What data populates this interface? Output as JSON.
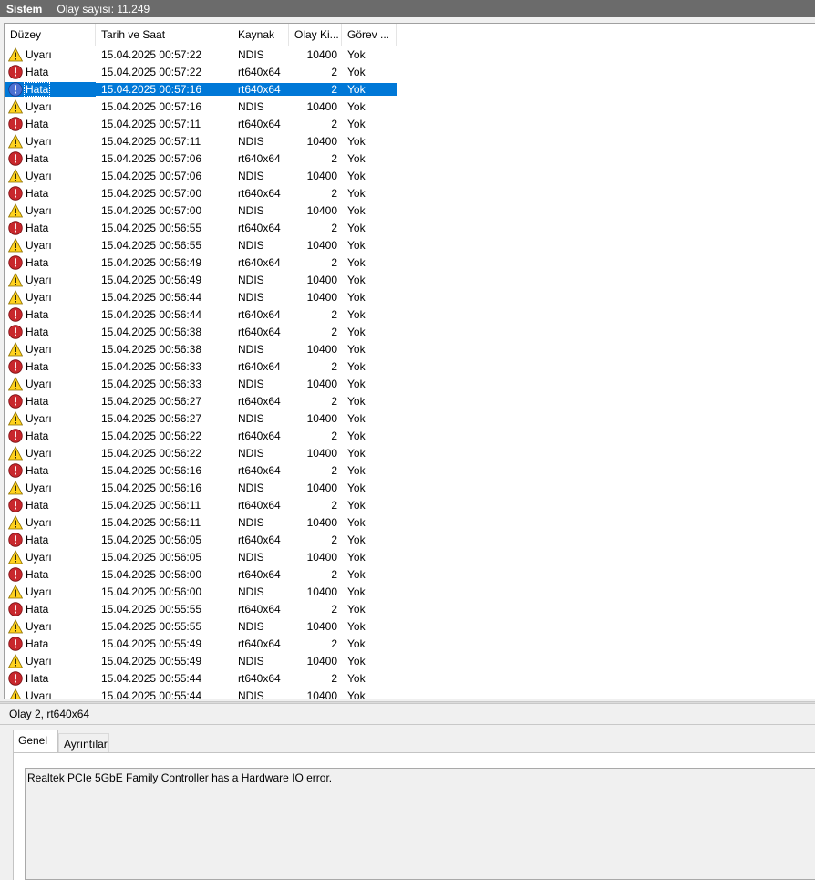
{
  "log": {
    "name": "Sistem",
    "count_text": "Olay sayısı: 11.249"
  },
  "columns": [
    "Düzey",
    "Tarih ve Saat",
    "Kaynak",
    "Olay Ki...",
    "Görev ..."
  ],
  "rows": [
    {
      "level": "Uyarı",
      "icon": "warning",
      "datetime": "15.04.2025 00:57:22",
      "source": "NDIS",
      "event_id": "10400",
      "task": "Yok"
    },
    {
      "level": "Hata",
      "icon": "error",
      "datetime": "15.04.2025 00:57:22",
      "source": "rt640x64",
      "event_id": "2",
      "task": "Yok"
    },
    {
      "level": "Hata",
      "icon": "error",
      "datetime": "15.04.2025 00:57:16",
      "source": "rt640x64",
      "event_id": "2",
      "task": "Yok",
      "selected": true
    },
    {
      "level": "Uyarı",
      "icon": "warning",
      "datetime": "15.04.2025 00:57:16",
      "source": "NDIS",
      "event_id": "10400",
      "task": "Yok"
    },
    {
      "level": "Hata",
      "icon": "error",
      "datetime": "15.04.2025 00:57:11",
      "source": "rt640x64",
      "event_id": "2",
      "task": "Yok"
    },
    {
      "level": "Uyarı",
      "icon": "warning",
      "datetime": "15.04.2025 00:57:11",
      "source": "NDIS",
      "event_id": "10400",
      "task": "Yok"
    },
    {
      "level": "Hata",
      "icon": "error",
      "datetime": "15.04.2025 00:57:06",
      "source": "rt640x64",
      "event_id": "2",
      "task": "Yok"
    },
    {
      "level": "Uyarı",
      "icon": "warning",
      "datetime": "15.04.2025 00:57:06",
      "source": "NDIS",
      "event_id": "10400",
      "task": "Yok"
    },
    {
      "level": "Hata",
      "icon": "error",
      "datetime": "15.04.2025 00:57:00",
      "source": "rt640x64",
      "event_id": "2",
      "task": "Yok"
    },
    {
      "level": "Uyarı",
      "icon": "warning",
      "datetime": "15.04.2025 00:57:00",
      "source": "NDIS",
      "event_id": "10400",
      "task": "Yok"
    },
    {
      "level": "Hata",
      "icon": "error",
      "datetime": "15.04.2025 00:56:55",
      "source": "rt640x64",
      "event_id": "2",
      "task": "Yok"
    },
    {
      "level": "Uyarı",
      "icon": "warning",
      "datetime": "15.04.2025 00:56:55",
      "source": "NDIS",
      "event_id": "10400",
      "task": "Yok"
    },
    {
      "level": "Hata",
      "icon": "error",
      "datetime": "15.04.2025 00:56:49",
      "source": "rt640x64",
      "event_id": "2",
      "task": "Yok"
    },
    {
      "level": "Uyarı",
      "icon": "warning",
      "datetime": "15.04.2025 00:56:49",
      "source": "NDIS",
      "event_id": "10400",
      "task": "Yok"
    },
    {
      "level": "Uyarı",
      "icon": "warning",
      "datetime": "15.04.2025 00:56:44",
      "source": "NDIS",
      "event_id": "10400",
      "task": "Yok"
    },
    {
      "level": "Hata",
      "icon": "error",
      "datetime": "15.04.2025 00:56:44",
      "source": "rt640x64",
      "event_id": "2",
      "task": "Yok"
    },
    {
      "level": "Hata",
      "icon": "error",
      "datetime": "15.04.2025 00:56:38",
      "source": "rt640x64",
      "event_id": "2",
      "task": "Yok"
    },
    {
      "level": "Uyarı",
      "icon": "warning",
      "datetime": "15.04.2025 00:56:38",
      "source": "NDIS",
      "event_id": "10400",
      "task": "Yok"
    },
    {
      "level": "Hata",
      "icon": "error",
      "datetime": "15.04.2025 00:56:33",
      "source": "rt640x64",
      "event_id": "2",
      "task": "Yok"
    },
    {
      "level": "Uyarı",
      "icon": "warning",
      "datetime": "15.04.2025 00:56:33",
      "source": "NDIS",
      "event_id": "10400",
      "task": "Yok"
    },
    {
      "level": "Hata",
      "icon": "error",
      "datetime": "15.04.2025 00:56:27",
      "source": "rt640x64",
      "event_id": "2",
      "task": "Yok"
    },
    {
      "level": "Uyarı",
      "icon": "warning",
      "datetime": "15.04.2025 00:56:27",
      "source": "NDIS",
      "event_id": "10400",
      "task": "Yok"
    },
    {
      "level": "Hata",
      "icon": "error",
      "datetime": "15.04.2025 00:56:22",
      "source": "rt640x64",
      "event_id": "2",
      "task": "Yok"
    },
    {
      "level": "Uyarı",
      "icon": "warning",
      "datetime": "15.04.2025 00:56:22",
      "source": "NDIS",
      "event_id": "10400",
      "task": "Yok"
    },
    {
      "level": "Hata",
      "icon": "error",
      "datetime": "15.04.2025 00:56:16",
      "source": "rt640x64",
      "event_id": "2",
      "task": "Yok"
    },
    {
      "level": "Uyarı",
      "icon": "warning",
      "datetime": "15.04.2025 00:56:16",
      "source": "NDIS",
      "event_id": "10400",
      "task": "Yok"
    },
    {
      "level": "Hata",
      "icon": "error",
      "datetime": "15.04.2025 00:56:11",
      "source": "rt640x64",
      "event_id": "2",
      "task": "Yok"
    },
    {
      "level": "Uyarı",
      "icon": "warning",
      "datetime": "15.04.2025 00:56:11",
      "source": "NDIS",
      "event_id": "10400",
      "task": "Yok"
    },
    {
      "level": "Hata",
      "icon": "error",
      "datetime": "15.04.2025 00:56:05",
      "source": "rt640x64",
      "event_id": "2",
      "task": "Yok"
    },
    {
      "level": "Uyarı",
      "icon": "warning",
      "datetime": "15.04.2025 00:56:05",
      "source": "NDIS",
      "event_id": "10400",
      "task": "Yok"
    },
    {
      "level": "Hata",
      "icon": "error",
      "datetime": "15.04.2025 00:56:00",
      "source": "rt640x64",
      "event_id": "2",
      "task": "Yok"
    },
    {
      "level": "Uyarı",
      "icon": "warning",
      "datetime": "15.04.2025 00:56:00",
      "source": "NDIS",
      "event_id": "10400",
      "task": "Yok"
    },
    {
      "level": "Hata",
      "icon": "error",
      "datetime": "15.04.2025 00:55:55",
      "source": "rt640x64",
      "event_id": "2",
      "task": "Yok"
    },
    {
      "level": "Uyarı",
      "icon": "warning",
      "datetime": "15.04.2025 00:55:55",
      "source": "NDIS",
      "event_id": "10400",
      "task": "Yok"
    },
    {
      "level": "Hata",
      "icon": "error",
      "datetime": "15.04.2025 00:55:49",
      "source": "rt640x64",
      "event_id": "2",
      "task": "Yok"
    },
    {
      "level": "Uyarı",
      "icon": "warning",
      "datetime": "15.04.2025 00:55:49",
      "source": "NDIS",
      "event_id": "10400",
      "task": "Yok"
    },
    {
      "level": "Hata",
      "icon": "error",
      "datetime": "15.04.2025 00:55:44",
      "source": "rt640x64",
      "event_id": "2",
      "task": "Yok"
    },
    {
      "level": "Uyarı",
      "icon": "warning",
      "datetime": "15.04.2025 00:55:44",
      "source": "NDIS",
      "event_id": "10400",
      "task": "Yok"
    }
  ],
  "detail": {
    "title": "Olay 2, rt640x64",
    "tabs": [
      "Genel",
      "Ayrıntılar"
    ],
    "description": "Realtek PCIe 5GbE Family Controller has a Hardware IO error."
  }
}
